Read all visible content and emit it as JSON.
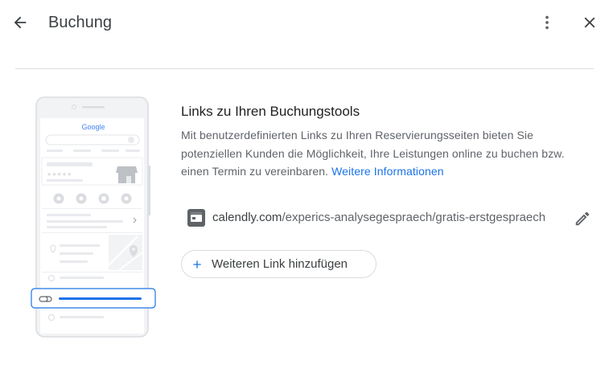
{
  "header": {
    "title": "Buchung",
    "back_icon": "arrow-back-icon",
    "more_icon": "more-vert-icon",
    "close_icon": "close-icon"
  },
  "illustration": {
    "logo_text": "Google",
    "stars": "★★★★★"
  },
  "main": {
    "section_title": "Links zu Ihren Buchungstools",
    "description": "Mit benutzerdefinierten Links zu Ihren Reservierungsseiten bieten Sie potenziellen Kunden die Möglichkeit, Ihre Leistungen online zu buchen bzw. einen Termin zu vereinbaren.",
    "more_info_link": "Weitere Informationen",
    "link_domain": "calendly.com",
    "link_path": "/experics-analysegespraech/gratis-erstgespraech",
    "add_button_label": "Weiteren Link hinzufügen"
  },
  "colors": {
    "accent": "#1a73e8",
    "text": "#3c4043",
    "secondary_text": "#5f6368",
    "divider": "#dadce0"
  }
}
